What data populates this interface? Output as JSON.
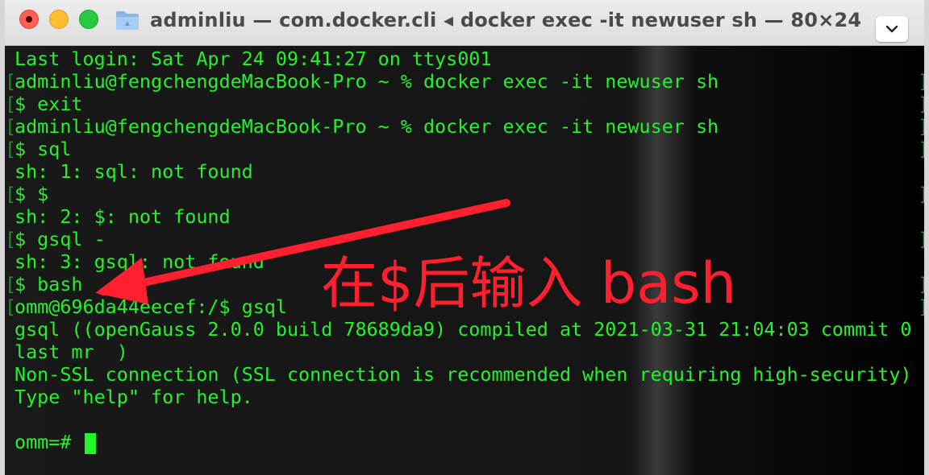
{
  "window": {
    "title": "adminliu — com.docker.cli ◂ docker exec -it newuser sh — 80×24",
    "icons": {
      "folder": "folder-icon",
      "menu": "chevron-down-icon"
    }
  },
  "terminal": {
    "lines": [
      {
        "text": "Last login: Sat Apr 24 09:41:27 on ttys001",
        "bracket": false
      },
      {
        "text": "adminliu@fengchengdeMacBook-Pro ~ % docker exec -it newuser sh",
        "bracket": true
      },
      {
        "text": "$ exit",
        "bracket": true
      },
      {
        "text": "adminliu@fengchengdeMacBook-Pro ~ % docker exec -it newuser sh",
        "bracket": true
      },
      {
        "text": "$ sql",
        "bracket": true
      },
      {
        "text": "sh: 1: sql: not found",
        "bracket": false
      },
      {
        "text": "$ $",
        "bracket": true
      },
      {
        "text": "sh: 2: $: not found",
        "bracket": false
      },
      {
        "text": "$ gsql -",
        "bracket": true
      },
      {
        "text": "sh: 3: gsql: not found",
        "bracket": false
      },
      {
        "text": "$ bash",
        "bracket": true
      },
      {
        "text": "omm@696da44eecef:/$ gsql",
        "bracket": true
      },
      {
        "text": "gsql ((openGauss 2.0.0 build 78689da9) compiled at 2021-03-31 21:04:03 commit 0",
        "bracket": false
      },
      {
        "text": "last mr  )",
        "bracket": false
      },
      {
        "text": "Non-SSL connection (SSL connection is recommended when requiring high-security)",
        "bracket": false
      },
      {
        "text": "Type \"help\" for help.",
        "bracket": false
      },
      {
        "text": "",
        "bracket": false
      },
      {
        "text": "omm=# ",
        "bracket": false,
        "cursor": true
      }
    ]
  },
  "annotation": {
    "text": "在$后输入 bash",
    "color": "#ff1f2e"
  },
  "colors": {
    "terminal_text": "#24f22a",
    "bracket": "#2b8c2d"
  }
}
